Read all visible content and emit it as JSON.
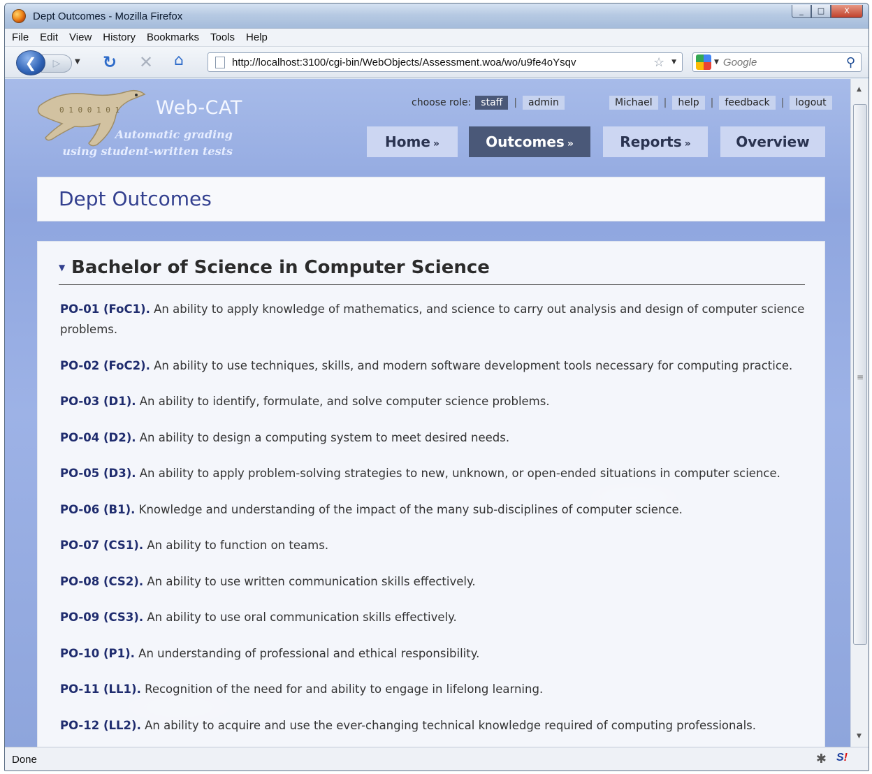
{
  "window": {
    "title": "Dept Outcomes - Mozilla Firefox",
    "controls": [
      "_",
      "□",
      "X"
    ]
  },
  "menubar": {
    "items": [
      "File",
      "Edit",
      "View",
      "History",
      "Bookmarks",
      "Tools",
      "Help"
    ]
  },
  "navbar": {
    "url": "http://localhost:3100/cgi-bin/WebObjects/Assessment.woa/wo/u9fe4oYsqv",
    "search_placeholder": "Google"
  },
  "header": {
    "brand": "Web-CAT",
    "tagline_line1": "Automatic grading",
    "tagline_line2": "using student-written tests",
    "role_label": "choose role:",
    "roles": [
      "staff",
      "admin"
    ],
    "user_links": [
      "Michael",
      "help",
      "feedback",
      "logout"
    ],
    "tabs": [
      {
        "label": "Home",
        "suffix": "»"
      },
      {
        "label": "Outcomes",
        "suffix": "»"
      },
      {
        "label": "Reports",
        "suffix": "»"
      },
      {
        "label": "Overview",
        "suffix": ""
      }
    ]
  },
  "page": {
    "title": "Dept Outcomes",
    "section_title": "Bachelor of Science in Computer Science",
    "outcomes": [
      {
        "code": "PO-01 (FoC1).",
        "text": "An ability to apply knowledge of mathematics, and science to carry out analysis and design of computer science problems."
      },
      {
        "code": "PO-02 (FoC2).",
        "text": "An ability to use techniques, skills, and modern software development tools necessary for computing practice."
      },
      {
        "code": "PO-03 (D1).",
        "text": "An ability to identify, formulate, and solve computer science problems."
      },
      {
        "code": "PO-04 (D2).",
        "text": "An ability to design a computing system to meet desired needs."
      },
      {
        "code": "PO-05 (D3).",
        "text": "An ability to apply problem-solving strategies to new, unknown, or open-ended situations in computer science."
      },
      {
        "code": "PO-06 (B1).",
        "text": "Knowledge and understanding of the impact of the many sub-disciplines of computer science."
      },
      {
        "code": "PO-07 (CS1).",
        "text": "An ability to function on teams."
      },
      {
        "code": "PO-08 (CS2).",
        "text": "An ability to use written communication skills effectively."
      },
      {
        "code": "PO-09 (CS3).",
        "text": "An ability to use oral communication skills effectively."
      },
      {
        "code": "PO-10 (P1).",
        "text": "An understanding of professional and ethical responsibility."
      },
      {
        "code": "PO-11 (LL1).",
        "text": "Recognition of the need for and ability to engage in lifelong learning."
      },
      {
        "code": "PO-12 (LL2).",
        "text": "An ability to acquire and use the ever-changing technical knowledge required of computing professionals."
      }
    ]
  },
  "status": {
    "text": "Done"
  }
}
